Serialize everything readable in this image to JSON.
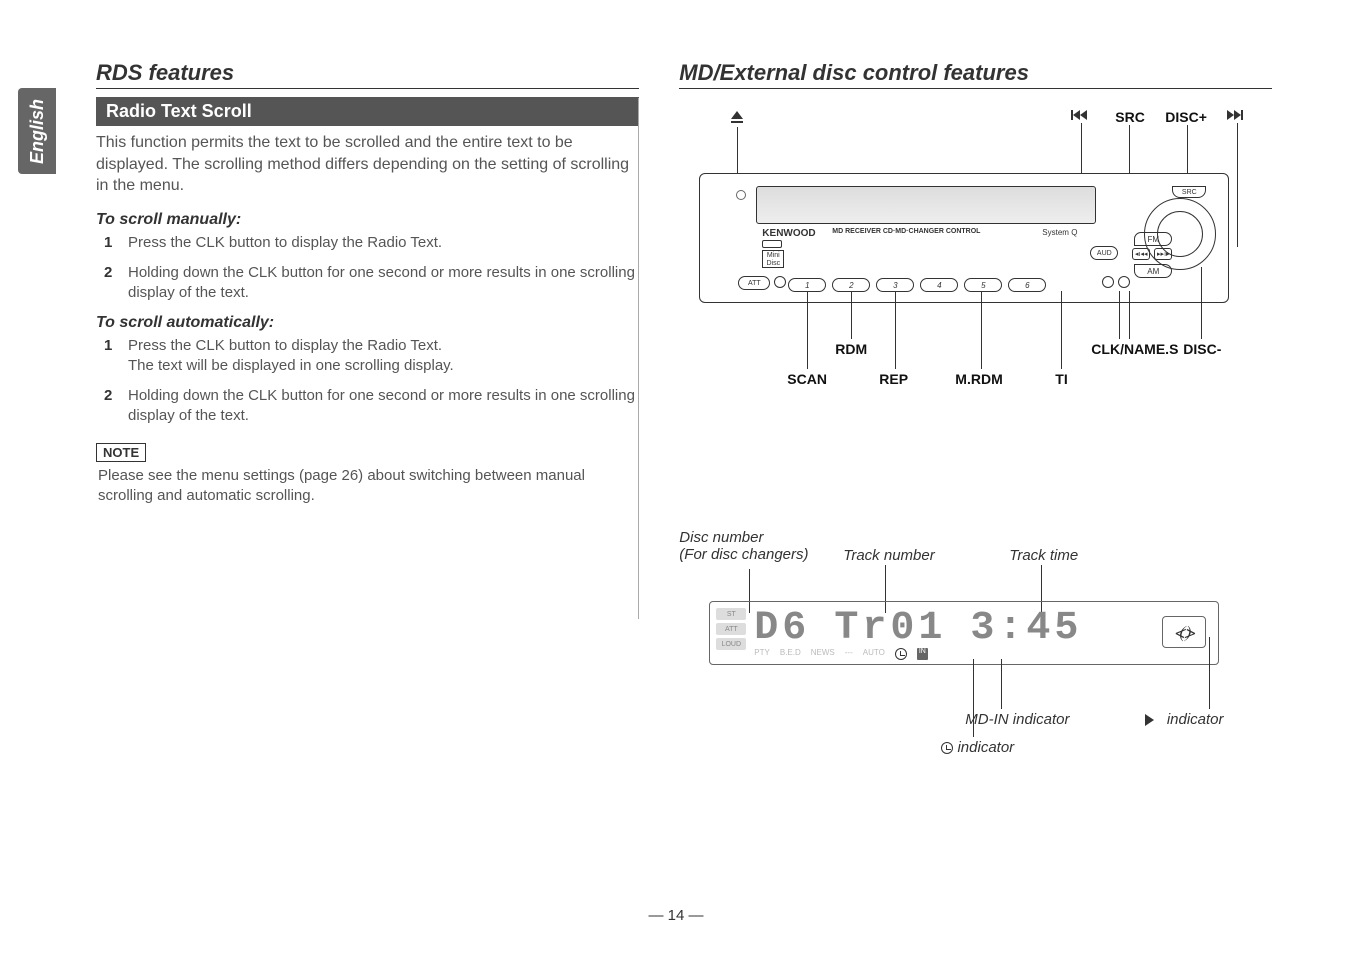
{
  "side_tab": "English",
  "left": {
    "title": "RDS features",
    "block_header": "Radio Text Scroll",
    "intro": "This function permits the text to be scrolled and the entire text to be displayed. The scrolling method differs depending on the setting of scrolling in the menu.",
    "sub1": "To scroll manually:",
    "s1_1_num": "1",
    "s1_1": "Press the CLK button to display the Radio Text.",
    "s1_2_num": "2",
    "s1_2": "Holding down the CLK button for one second or more results in one scrolling display of the text.",
    "sub2": "To scroll automatically:",
    "s2_1_num": "1",
    "s2_1a": "Press the CLK button to display the Radio Text.",
    "s2_1b": "The text will be displayed in one scrolling display.",
    "s2_2_num": "2",
    "s2_2": "Holding down the CLK button for one second or more results in one scrolling display of the text.",
    "note_label": "NOTE",
    "note_text": "Please see the menu settings (page 26) about switching between manual scrolling and automatic scrolling."
  },
  "right": {
    "title": "MD/External disc control features",
    "device": {
      "brand": "KENWOOD",
      "brand_sub": "MD RECEIVER CD·MD·CHANGER CONTROL",
      "system": "System Q",
      "minidisc": "Mini\nDisc",
      "aud": "AUD",
      "fm": "FM",
      "am": "AM",
      "src": "SRC",
      "att": "ATT",
      "preset": [
        "1",
        "2",
        "3",
        "4",
        "5",
        "6"
      ],
      "top_labels": {
        "src": "SRC",
        "disc_plus": "DISC+"
      },
      "bottom_labels": {
        "scan": "SCAN",
        "rdm": "RDM",
        "rep": "REP",
        "mrdm": "M.RDM",
        "ti": "TI",
        "clk": "CLK/NAME.S",
        "disc_minus": "DISC-"
      }
    },
    "lcd": {
      "callouts": {
        "disc_num": "Disc number\n(For disc changers)",
        "track_num": "Track number",
        "track_time": "Track time",
        "mdin": "MD-IN indicator",
        "play": "indicator",
        "clock": "indicator"
      },
      "badges": [
        "ST",
        "ATT",
        "LOUD"
      ],
      "digits": {
        "disc": "D6",
        "track": "Tr01",
        "time": "3:45"
      },
      "bottom": [
        "PTY",
        "B.E.D",
        "NEWS",
        "---",
        "AUTO",
        "",
        "",
        "IN"
      ]
    }
  },
  "page_number": "— 14 —"
}
